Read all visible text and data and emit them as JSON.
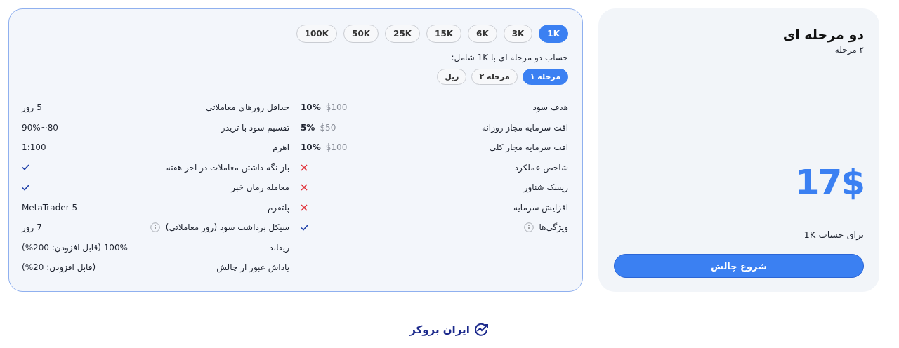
{
  "plan": {
    "title": "دو مرحله ای",
    "subtitle": "۲ مرحله",
    "price": "17$",
    "caption": "برای حساب 1K",
    "button": "شروع چالش"
  },
  "sizes": [
    {
      "label": "1K",
      "selected": true
    },
    {
      "label": "3K",
      "selected": false
    },
    {
      "label": "6K",
      "selected": false
    },
    {
      "label": "15K",
      "selected": false
    },
    {
      "label": "25K",
      "selected": false
    },
    {
      "label": "50K",
      "selected": false
    },
    {
      "label": "100K",
      "selected": false
    }
  ],
  "intro": "حساب دو مرحله ای با 1K شامل:",
  "phases": [
    {
      "label": "مرحله ۱",
      "selected": true
    },
    {
      "label": "مرحله ۲",
      "selected": false
    },
    {
      "label": "ریل",
      "selected": false
    }
  ],
  "columns": [
    [
      {
        "label": "هدف سود",
        "info": false,
        "kind": "amount",
        "amount": "$100",
        "percent": "10%"
      },
      {
        "label": "افت سرمایه مجاز روزانه",
        "info": false,
        "kind": "amount",
        "amount": "$50",
        "percent": "5%"
      },
      {
        "label": "افت سرمایه مجاز کلی",
        "info": false,
        "kind": "amount",
        "amount": "$100",
        "percent": "10%"
      },
      {
        "label": "شاخص عملکرد",
        "info": false,
        "kind": "cross"
      },
      {
        "label": "ریسک شناور",
        "info": false,
        "kind": "cross"
      },
      {
        "label": "افزایش سرمایه",
        "info": false,
        "kind": "cross"
      },
      {
        "label": "ویژگی‌ها",
        "info": true,
        "kind": "check"
      }
    ],
    [
      {
        "label": "حداقل روزهای معاملاتی",
        "info": false,
        "kind": "text",
        "value": "5 روز"
      },
      {
        "label": "تقسیم سود با تریدر",
        "info": false,
        "kind": "text",
        "value": "80~90%"
      },
      {
        "label": "اهرم",
        "info": false,
        "kind": "text",
        "value": "1:100"
      },
      {
        "label": "باز نگه داشتن معاملات در آخر هفته",
        "info": false,
        "kind": "check"
      },
      {
        "label": "معامله زمان خبر",
        "info": false,
        "kind": "check"
      },
      {
        "label": "پلتفرم",
        "info": false,
        "kind": "text",
        "value": "MetaTrader 5"
      },
      {
        "label": "سیکل برداشت سود (روز معاملاتی)",
        "info": true,
        "kind": "text",
        "value": "7 روز"
      },
      {
        "label": "ریفاند",
        "info": false,
        "kind": "text",
        "value": "100% (قابل افزودن: 200%)"
      },
      {
        "label": "پاداش عبور از چالش",
        "info": false,
        "kind": "text",
        "value": "(قابل افزودن: 20%)"
      }
    ]
  ],
  "footer": {
    "brand": "ایران بروکر"
  }
}
